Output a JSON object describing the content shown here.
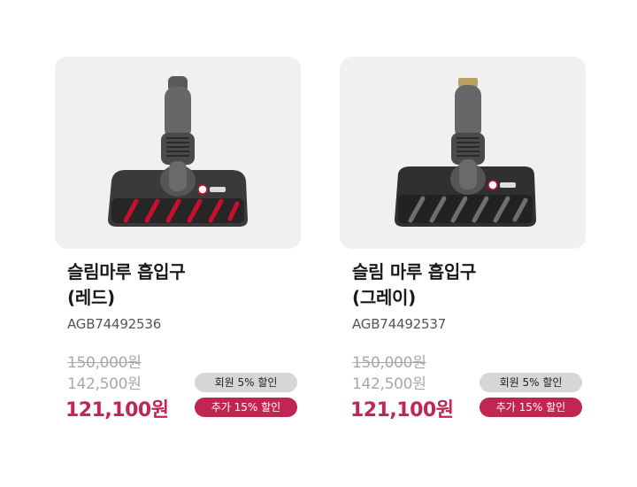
{
  "colors": {
    "accent": "#c12551",
    "badge_grey": "#d6d6d6",
    "thumb_bg": "#f0f0f0"
  },
  "products": [
    {
      "title_line1": "슬림마루 흡입구",
      "title_line2": "(레드)",
      "sku": "AGB74492536",
      "original_price": "150,000원",
      "member_price": "142,500원",
      "final_price": "121,100원",
      "member_badge": "회원 5% 할인",
      "extra_badge": "추가 15% 할인",
      "stripe_color": "#c8102e"
    },
    {
      "title_line1": "슬림 마루 흡입구",
      "title_line2": "(그레이)",
      "sku": "AGB74492537",
      "original_price": "150,000원",
      "member_price": "142,500원",
      "final_price": "121,100원",
      "member_badge": "회원 5% 할인",
      "extra_badge": "추가 15% 할인",
      "stripe_color": "#6f6f6f"
    }
  ]
}
